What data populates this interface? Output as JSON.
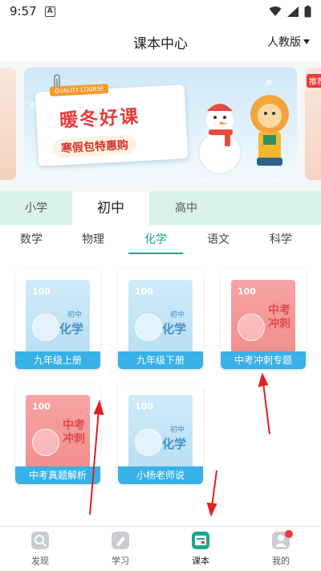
{
  "status_bar": {
    "time": "9:57",
    "notification_icon": "a-icon",
    "wifi_icon": "wifi-icon",
    "signal_icon": "signal-icon",
    "battery_icon": "battery-icon"
  },
  "header": {
    "title": "课本中心",
    "edition_label": "人教版",
    "edition_icon": "caret-down-icon"
  },
  "banner": {
    "badge": "QUALITY COURSE",
    "headline": "暖冬好课",
    "subline": "寒假包特惠购",
    "right_peek_tag": "推荐"
  },
  "stages": [
    {
      "label": "小学",
      "active": false
    },
    {
      "label": "初中",
      "active": true
    },
    {
      "label": "高中",
      "active": false
    }
  ],
  "subjects": [
    {
      "label": "数学",
      "active": false
    },
    {
      "label": "物理",
      "active": false
    },
    {
      "label": "化学",
      "active": true
    },
    {
      "label": "语文",
      "active": false
    },
    {
      "label": "科学",
      "active": false
    }
  ],
  "books": [
    {
      "label": "九年级上册",
      "cover": "blue",
      "logo": "100",
      "level": "初中",
      "subject": "化学"
    },
    {
      "label": "九年级下册",
      "cover": "blue",
      "logo": "100",
      "level": "初中",
      "subject": "化学"
    },
    {
      "label": "中考冲刺专题",
      "cover": "red",
      "logo": "100",
      "zk1": "中考",
      "zk2": "冲刺"
    },
    {
      "label": "中考真题解析",
      "cover": "red",
      "logo": "100",
      "zk1": "中考",
      "zk2": "冲刺"
    },
    {
      "label": "小杨老师说",
      "cover": "blue",
      "logo": "100",
      "level": "初中",
      "subject": "化学"
    }
  ],
  "bottom_nav": [
    {
      "label": "发现",
      "icon": "discover-icon",
      "active": false
    },
    {
      "label": "学习",
      "icon": "study-icon",
      "active": false
    },
    {
      "label": "课本",
      "icon": "textbook-icon",
      "active": true
    },
    {
      "label": "我的",
      "icon": "profile-icon",
      "active": false
    }
  ],
  "colors": {
    "accent": "#1aa889",
    "book_label": "#38b0e8",
    "annotation_arrow": "#e02020",
    "stage_bar": "#d9f2ec"
  }
}
